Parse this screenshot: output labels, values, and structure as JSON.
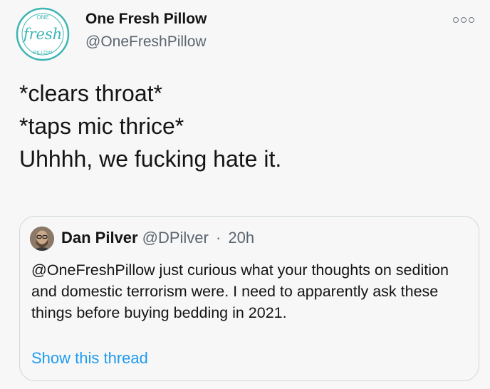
{
  "author": {
    "display_name": "One Fresh Pillow",
    "handle": "@OneFreshPillow",
    "logo_text": {
      "top": "ONE",
      "middle": "fresh",
      "bottom": "PILLOW"
    }
  },
  "tweet": {
    "lines": [
      "*clears throat*",
      "*taps mic thrice*",
      "",
      "Uhhhh, we fucking hate it."
    ]
  },
  "quoted_tweet": {
    "display_name": "Dan Pilver",
    "handle": "@DPilver",
    "separator": "·",
    "time": "20h",
    "text": "@OneFreshPillow just curious what your thoughts on sedition and domestic terrorism were. I need to apparently ask these things before buying bedding in 2021.",
    "show_thread": "Show this thread"
  },
  "icons": {
    "more": "more-horizontal-icon",
    "avatar": "avatar"
  },
  "colors": {
    "link": "#1d9bf0",
    "secondary_text": "#5b6570",
    "brand_teal": "#3fb4b4"
  }
}
